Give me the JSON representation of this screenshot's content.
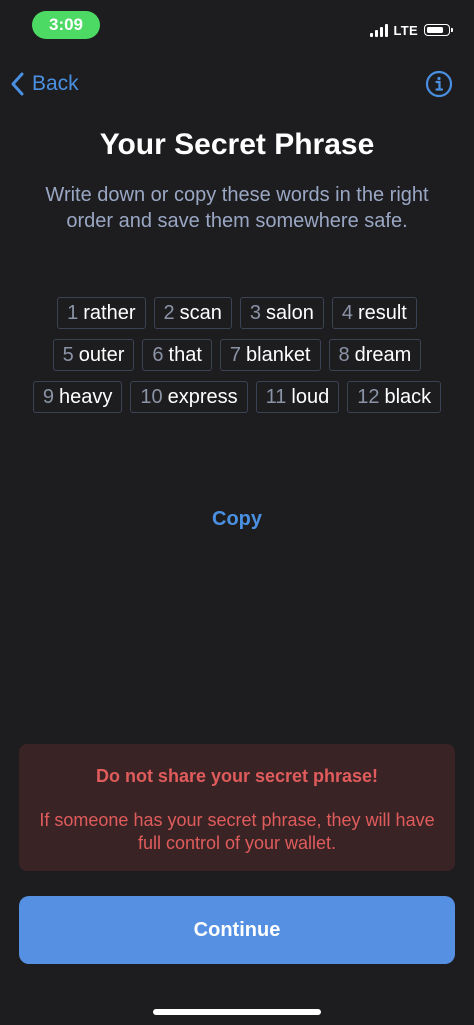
{
  "status_bar": {
    "time": "3:09",
    "network": "LTE"
  },
  "nav": {
    "back_label": "Back",
    "back_icon": "chevron-left-icon",
    "info_icon": "info-icon"
  },
  "title": "Your Secret Phrase",
  "subtitle": "Write down or copy these words in the right order and save them somewhere safe.",
  "words": [
    {
      "num": "1",
      "word": "rather"
    },
    {
      "num": "2",
      "word": "scan"
    },
    {
      "num": "3",
      "word": "salon"
    },
    {
      "num": "4",
      "word": "result"
    },
    {
      "num": "5",
      "word": "outer"
    },
    {
      "num": "6",
      "word": "that"
    },
    {
      "num": "7",
      "word": "blanket"
    },
    {
      "num": "8",
      "word": "dream"
    },
    {
      "num": "9",
      "word": "heavy"
    },
    {
      "num": "10",
      "word": "express"
    },
    {
      "num": "11",
      "word": "loud"
    },
    {
      "num": "12",
      "word": "black"
    }
  ],
  "copy_label": "Copy",
  "warning": {
    "title": "Do not share your secret phrase!",
    "body": "If someone has your secret phrase, they will have full control of your wallet."
  },
  "continue_label": "Continue",
  "colors": {
    "background": "#1d1d1f",
    "accent": "#4a90e2",
    "button": "#5590e3",
    "warning_bg": "#3a2325",
    "warning_text": "#e05c5c",
    "time_pill": "#4cd964"
  }
}
